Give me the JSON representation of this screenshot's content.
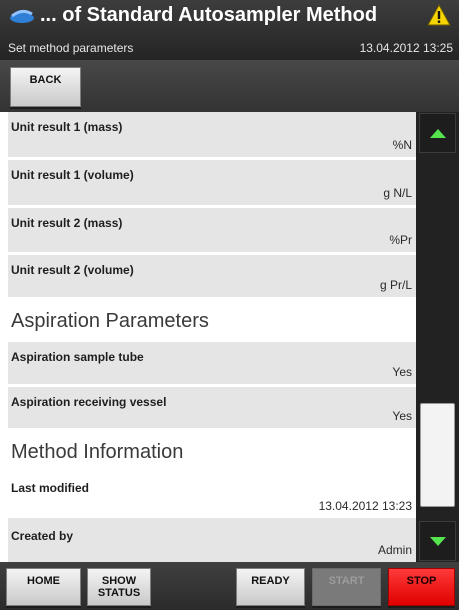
{
  "header": {
    "title": "... of Standard Autosampler Method",
    "subtitle": "Set method parameters",
    "datetime": "13.04.2012 13:25",
    "app_icon": "instrument-icon",
    "warning_icon": "warning-triangle-icon",
    "warning_color": "#f5d400"
  },
  "toolbar": {
    "back_label": "BACK"
  },
  "rows": [
    {
      "label": "Unit result 1 (mass)",
      "value": "%N"
    },
    {
      "label": "Unit result 1 (volume)",
      "value": "g N/L"
    },
    {
      "label": "Unit result 2 (mass)",
      "value": "%Pr"
    },
    {
      "label": "Unit result 2 (volume)",
      "value": "g Pr/L"
    }
  ],
  "sections": [
    {
      "title": "Aspiration Parameters",
      "rows": [
        {
          "label": "Aspiration sample tube",
          "value": "Yes"
        },
        {
          "label": "Aspiration receiving vessel",
          "value": "Yes"
        }
      ]
    },
    {
      "title": "Method Information",
      "rows": [
        {
          "label": "Last modified",
          "value": "13.04.2012 13:23"
        },
        {
          "label": "Created by",
          "value": "Admin"
        }
      ]
    }
  ],
  "scrollbar": {
    "up_icon": "scroll-up-arrow-icon",
    "down_icon": "scroll-down-arrow-icon",
    "arrow_color": "#55e44e"
  },
  "bottombar": {
    "home_label": "HOME",
    "show_status_label": "SHOW STATUS",
    "ready_label": "READY",
    "start_label": "START",
    "stop_label": "STOP",
    "stop_color": "#ff2a2a"
  }
}
